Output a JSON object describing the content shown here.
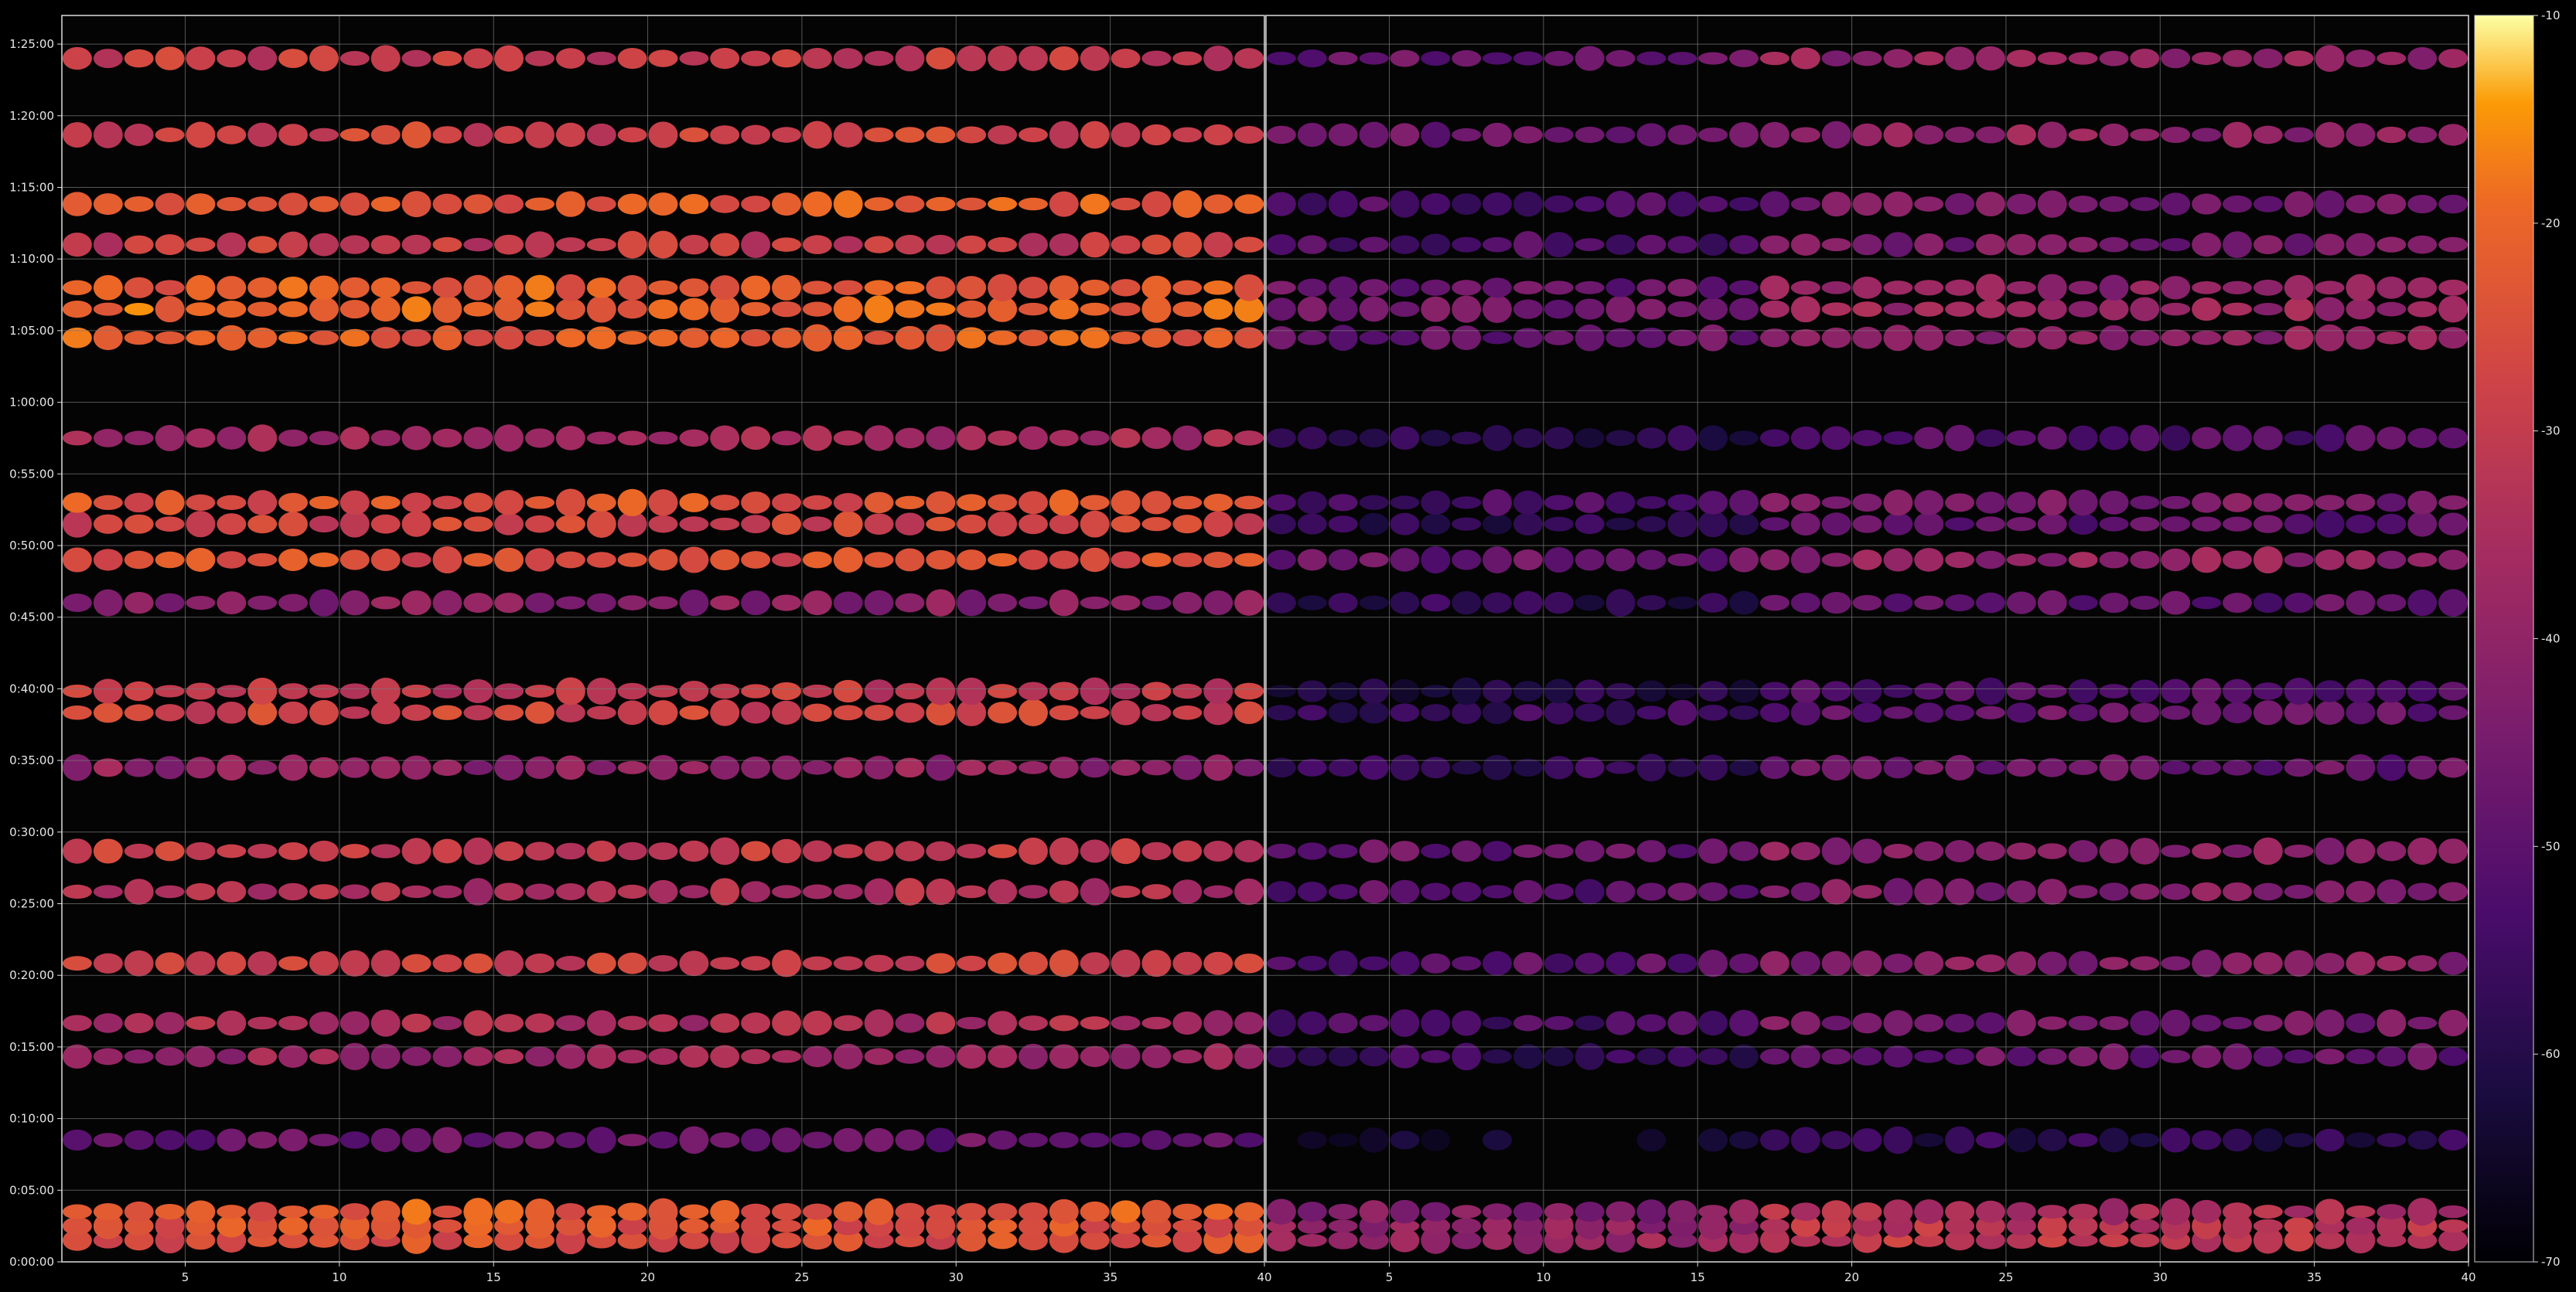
{
  "chart_data": {
    "type": "heatmap",
    "title": "",
    "xlabel": "",
    "ylabel": "",
    "panels": [
      {
        "name": "",
        "x_ticks": [
          "5",
          "10",
          "15",
          "20",
          "25",
          "30",
          "35",
          "40"
        ],
        "xlim": [
          1,
          40
        ]
      },
      {
        "name": "",
        "x_ticks": [
          "5",
          "10",
          "15",
          "20",
          "25",
          "30",
          "35",
          "40"
        ],
        "xlim": [
          1,
          40
        ]
      }
    ],
    "y_ticks": [
      "0:00:00",
      "0:05:00",
      "0:10:00",
      "0:15:00",
      "0:20:00",
      "0:25:00",
      "0:30:00",
      "0:35:00",
      "0:40:00",
      "0:45:00",
      "0:50:00",
      "0:55:00",
      "1:00:00",
      "1:05:00",
      "1:10:00",
      "1:15:00",
      "1:20:00",
      "1:25:00"
    ],
    "ylim_seconds": [
      0,
      5220
    ],
    "grid": true,
    "colorbar": {
      "ticks": [
        "-10",
        "-20",
        "-30",
        "-40",
        "-50",
        "-60",
        "-70"
      ],
      "range": [
        -70,
        -10
      ],
      "colormap": "inferno"
    },
    "note_rows": [
      {
        "time": "0:01:30",
        "left": -25,
        "right": -30
      },
      {
        "time": "0:02:30",
        "left": -24,
        "right": -32
      },
      {
        "time": "0:03:30",
        "left": -22,
        "right": -34
      },
      {
        "time": "0:08:30",
        "left": -48,
        "right": -58
      },
      {
        "time": "0:14:20",
        "left": -38,
        "right": -48
      },
      {
        "time": "0:16:40",
        "left": -35,
        "right": -45
      },
      {
        "time": "0:20:50",
        "left": -28,
        "right": -42
      },
      {
        "time": "0:25:50",
        "left": -34,
        "right": -42
      },
      {
        "time": "0:28:40",
        "left": -30,
        "right": -40
      },
      {
        "time": "0:34:30",
        "left": -40,
        "right": -48
      },
      {
        "time": "0:38:20",
        "left": -28,
        "right": -48
      },
      {
        "time": "0:39:50",
        "left": -30,
        "right": -52
      },
      {
        "time": "0:46:00",
        "left": -42,
        "right": -50
      },
      {
        "time": "0:49:00",
        "left": -25,
        "right": -40
      },
      {
        "time": "0:51:30",
        "left": -28,
        "right": -50
      },
      {
        "time": "0:53:00",
        "left": -24,
        "right": -45
      },
      {
        "time": "0:57:30",
        "left": -36,
        "right": -52
      },
      {
        "time": "1:04:30",
        "left": -22,
        "right": -40
      },
      {
        "time": "1:06:30",
        "left": -20,
        "right": -38
      },
      {
        "time": "1:08:00",
        "left": -22,
        "right": -40
      },
      {
        "time": "1:11:00",
        "left": -30,
        "right": -45
      },
      {
        "time": "1:13:50",
        "left": -22,
        "right": -45
      },
      {
        "time": "1:18:40",
        "left": -28,
        "right": -40
      },
      {
        "time": "1:24:00",
        "left": -30,
        "right": -40
      }
    ]
  }
}
